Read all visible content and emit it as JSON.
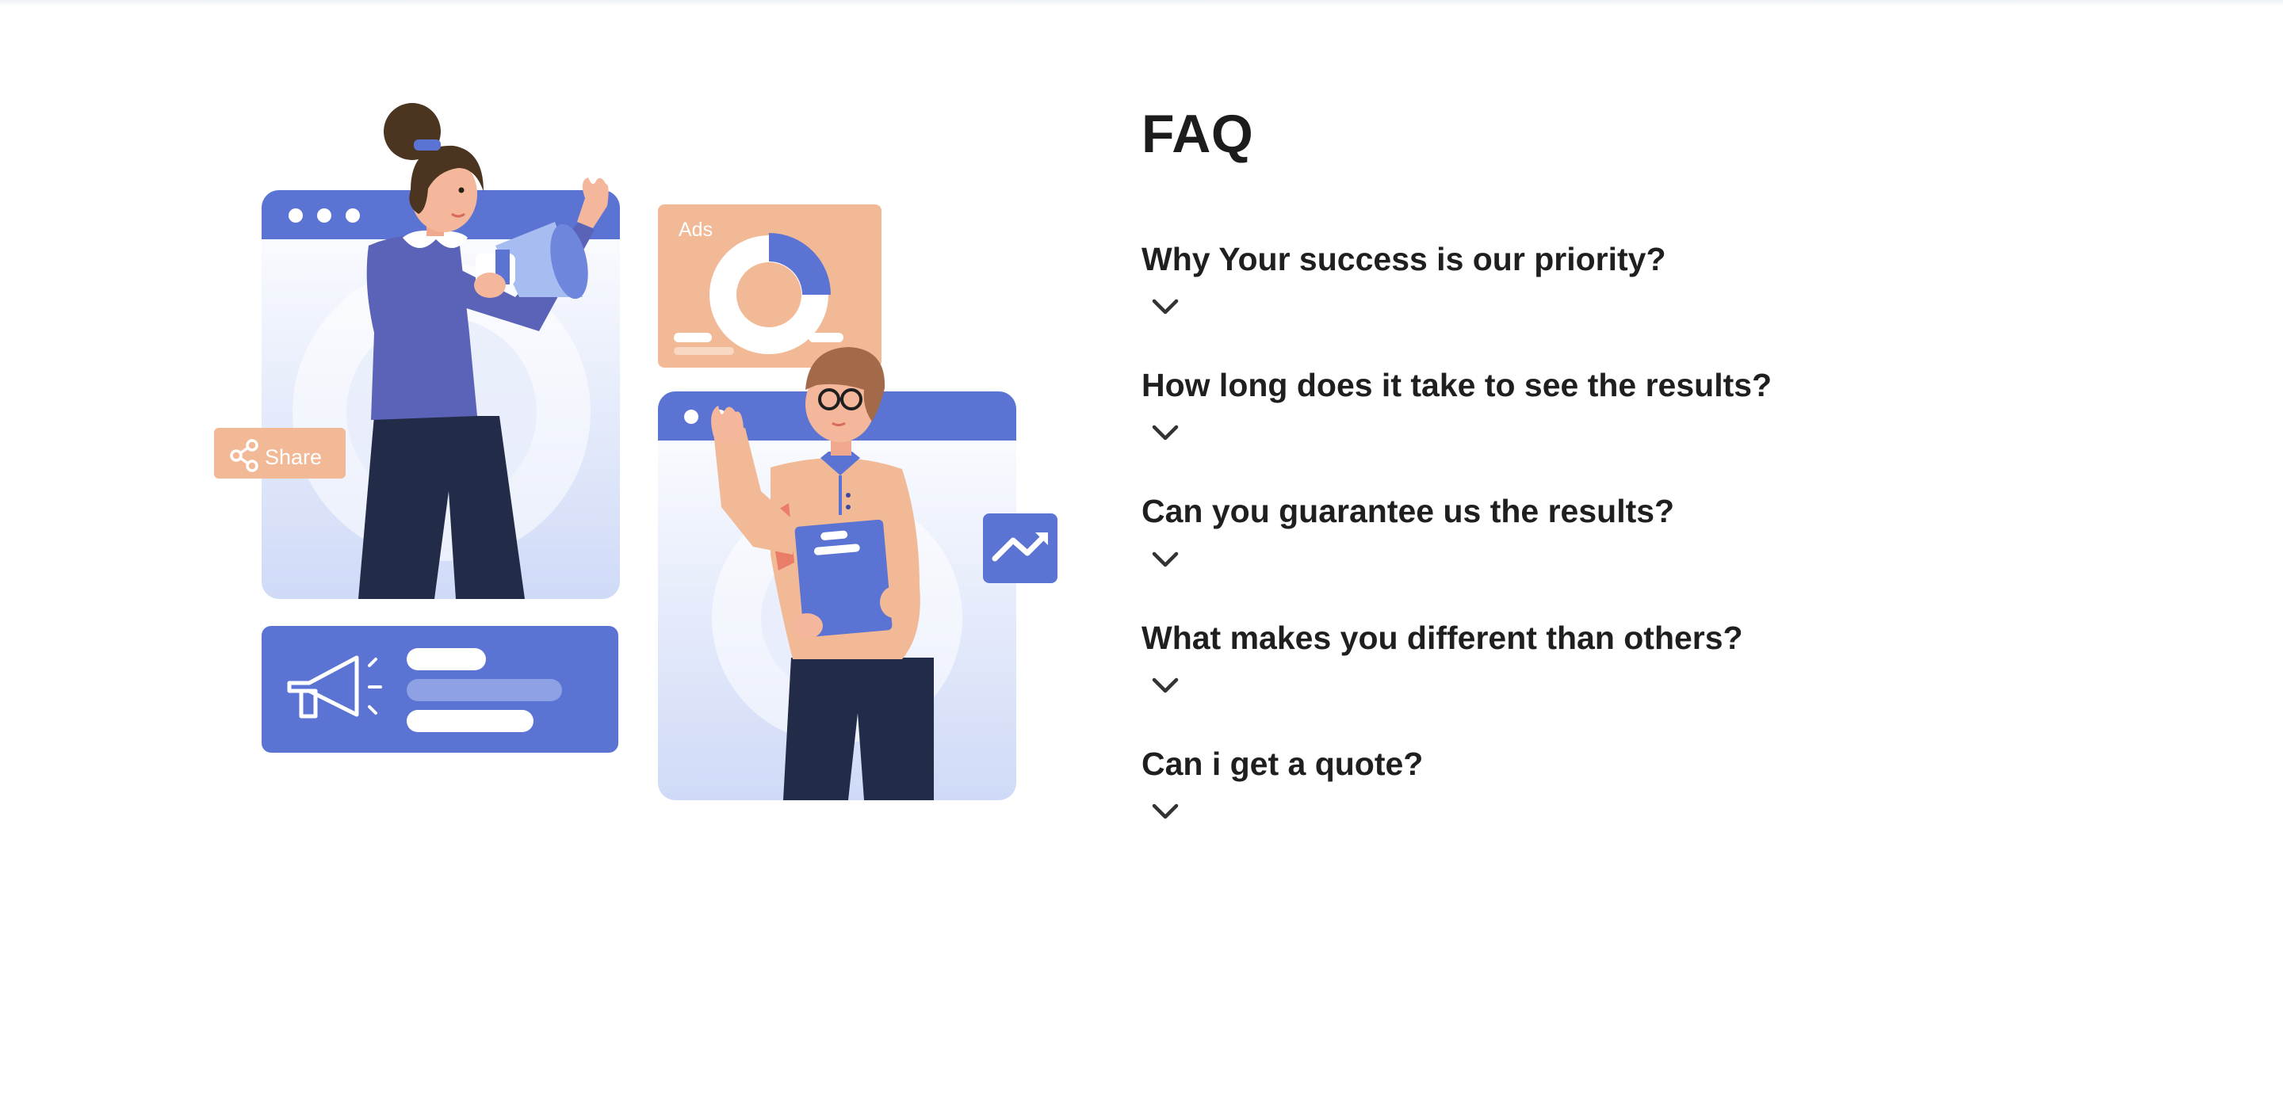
{
  "illustration": {
    "ads_label": "Ads",
    "share_label": "Share",
    "colors": {
      "blue": "#5b74d3",
      "peach": "#f2b996",
      "navy": "#222c48",
      "panel_light": "#f1f4fd"
    }
  },
  "faq": {
    "title": "FAQ",
    "items": [
      {
        "question": "Why Your success is our priority?",
        "toggle_icon": "chevron-down-icon"
      },
      {
        "question": "How long does it take to see the results?",
        "toggle_icon": "chevron-down-icon"
      },
      {
        "question": "Can you guarantee us the results?",
        "toggle_icon": "chevron-down-icon"
      },
      {
        "question": "What makes you different than others?",
        "toggle_icon": "chevron-down-icon"
      },
      {
        "question": "Can i get a quote?",
        "toggle_icon": "chevron-down-icon"
      }
    ]
  }
}
